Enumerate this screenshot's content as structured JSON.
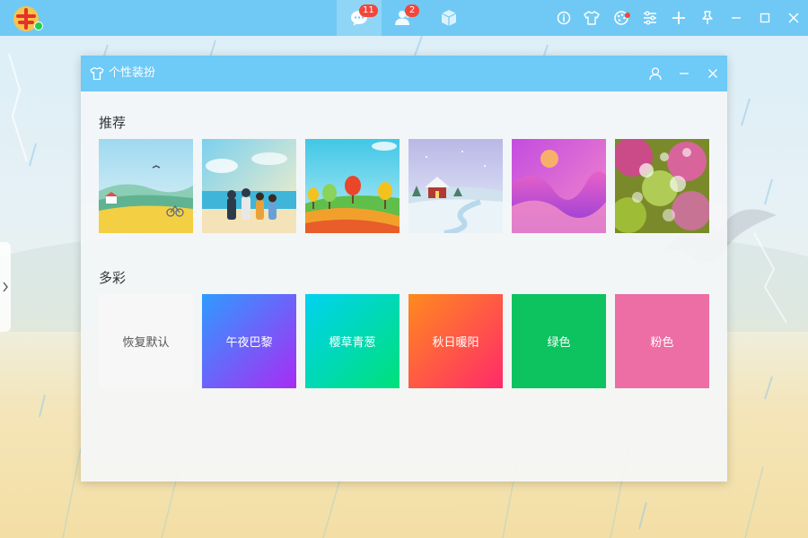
{
  "topbar": {
    "nav": [
      {
        "name": "messages",
        "badge": "11"
      },
      {
        "name": "contacts",
        "badge": "2"
      },
      {
        "name": "apps",
        "badge": ""
      }
    ],
    "icons": [
      "info-icon",
      "shirt-icon",
      "palette-icon",
      "settings-icon",
      "plus-icon",
      "pin-icon",
      "minimize-icon",
      "maximize-icon",
      "close-icon"
    ]
  },
  "dialog": {
    "title": "个性装扮",
    "recommend_title": "推荐",
    "colorful_title": "多彩",
    "recommend": [
      {
        "name": "rural-fields"
      },
      {
        "name": "beach-friends"
      },
      {
        "name": "autumn-trees"
      },
      {
        "name": "snowy-cabin"
      },
      {
        "name": "purple-waves"
      },
      {
        "name": "bokeh-lights"
      }
    ],
    "colors": [
      {
        "label": "恢复默认",
        "color": "#f7f7f7",
        "text": "#555555"
      },
      {
        "label": "午夜巴黎",
        "gradient": [
          "#2f9bff",
          "#a82cf4"
        ]
      },
      {
        "label": "樱草青葱",
        "gradient": [
          "#00d2f0",
          "#00e07a"
        ]
      },
      {
        "label": "秋日暖阳",
        "gradient": [
          "#ff8a1e",
          "#ff2a6a"
        ]
      },
      {
        "label": "绿色",
        "color": "#0cc35f"
      },
      {
        "label": "粉色",
        "color": "#ec6ea5"
      }
    ]
  }
}
